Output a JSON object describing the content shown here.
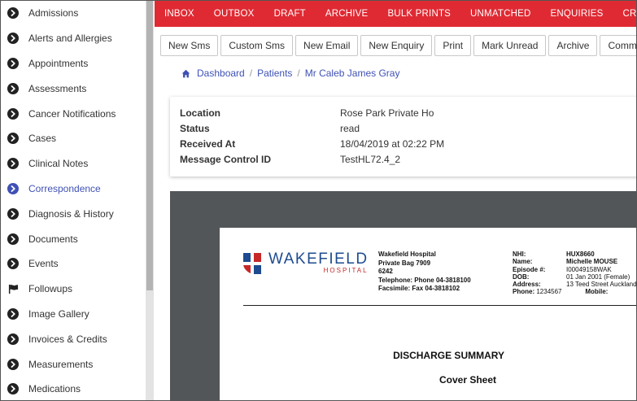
{
  "sidebar": {
    "items": [
      {
        "label": "Admissions",
        "icon": "chevron-circle-right-icon"
      },
      {
        "label": "Alerts and Allergies",
        "icon": "chevron-circle-right-icon"
      },
      {
        "label": "Appointments",
        "icon": "chevron-circle-right-icon"
      },
      {
        "label": "Assessments",
        "icon": "chevron-circle-right-icon"
      },
      {
        "label": "Cancer Notifications",
        "icon": "chevron-circle-right-icon"
      },
      {
        "label": "Cases",
        "icon": "chevron-circle-right-icon"
      },
      {
        "label": "Clinical Notes",
        "icon": "chevron-circle-right-icon"
      },
      {
        "label": "Correspondence",
        "icon": "chevron-circle-right-icon",
        "active": true
      },
      {
        "label": "Diagnosis & History",
        "icon": "chevron-circle-right-icon"
      },
      {
        "label": "Documents",
        "icon": "chevron-circle-right-icon"
      },
      {
        "label": "Events",
        "icon": "chevron-circle-right-icon"
      },
      {
        "label": "Followups",
        "icon": "flag-icon"
      },
      {
        "label": "Image Gallery",
        "icon": "chevron-circle-right-icon"
      },
      {
        "label": "Invoices & Credits",
        "icon": "chevron-circle-right-icon"
      },
      {
        "label": "Measurements",
        "icon": "chevron-circle-right-icon"
      },
      {
        "label": "Medications",
        "icon": "chevron-circle-right-icon"
      }
    ],
    "active_color": "#3f51b5"
  },
  "topnav": {
    "color": "#e02a33",
    "items": [
      "INBOX",
      "OUTBOX",
      "DRAFT",
      "ARCHIVE",
      "BULK PRINTS",
      "UNMATCHED",
      "ENQUIRIES",
      "CREATE"
    ]
  },
  "toolbar": {
    "buttons": [
      "New Sms",
      "Custom Sms",
      "New Email",
      "New Enquiry",
      "Print",
      "Mark Unread",
      "Archive",
      "Comment"
    ]
  },
  "breadcrumb": {
    "home_icon": "home-icon",
    "items": [
      "Dashboard",
      "Patients",
      "Mr Caleb James Gray"
    ]
  },
  "info": {
    "rows": [
      {
        "label": "Location",
        "value": "Rose Park Private Ho"
      },
      {
        "label": "Status",
        "value": "read"
      },
      {
        "label": "Received At",
        "value": "18/04/2019 at 02:22 PM"
      },
      {
        "label": "Message Control ID",
        "value": "TestHL72.4_2"
      }
    ]
  },
  "document": {
    "logo_main": "WAKEFIELD",
    "logo_sub": "HOSPITAL",
    "hospital_lines": [
      "Wakefield Hospital",
      "Private Bag 7909",
      "6242",
      "Telephone: Phone 04-3818100",
      "Facsimile: Fax 04-3818102"
    ],
    "patient": {
      "nhi_label": "NHI:",
      "nhi": "HUX8660",
      "name_label": "Name:",
      "name": "Michelle MOUSE",
      "episode_label": "Episode #:",
      "episode": "I00049158WAK",
      "dob_label": "DOB:",
      "dob": "01 Jan 2001 (Female)",
      "address_label": "Address:",
      "address": "13 Teed Street Auckland",
      "phone_label": "Phone:",
      "phone": "1234567",
      "mobile_label": "Mobile:"
    },
    "title": "DISCHARGE SUMMARY",
    "subtitle": "Cover Sheet"
  }
}
